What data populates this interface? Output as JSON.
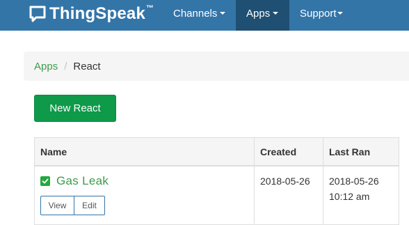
{
  "navbar": {
    "brand": "ThingSpeak",
    "brand_tm": "™",
    "items": [
      {
        "label": "Channels"
      },
      {
        "label": "Apps"
      },
      {
        "label": "Support"
      }
    ],
    "active_item": "Apps",
    "colors": {
      "bar": "#3475a8",
      "active": "#1f4f72"
    }
  },
  "breadcrumb": {
    "parent": "Apps",
    "separator": "/",
    "current": "React"
  },
  "actions": {
    "new_react_label": "New React"
  },
  "table": {
    "headers": {
      "name": "Name",
      "created": "Created",
      "last_ran": "Last Ran"
    },
    "rows": [
      {
        "name": "Gas Leak",
        "enabled": true,
        "created": "2018-05-26",
        "last_ran": "2018-05-26 10:12 am",
        "view_label": "View",
        "edit_label": "Edit"
      }
    ]
  },
  "colors": {
    "link": "#3a9c4b",
    "primary_button": "#0e9a49",
    "check": "#23a83f"
  }
}
